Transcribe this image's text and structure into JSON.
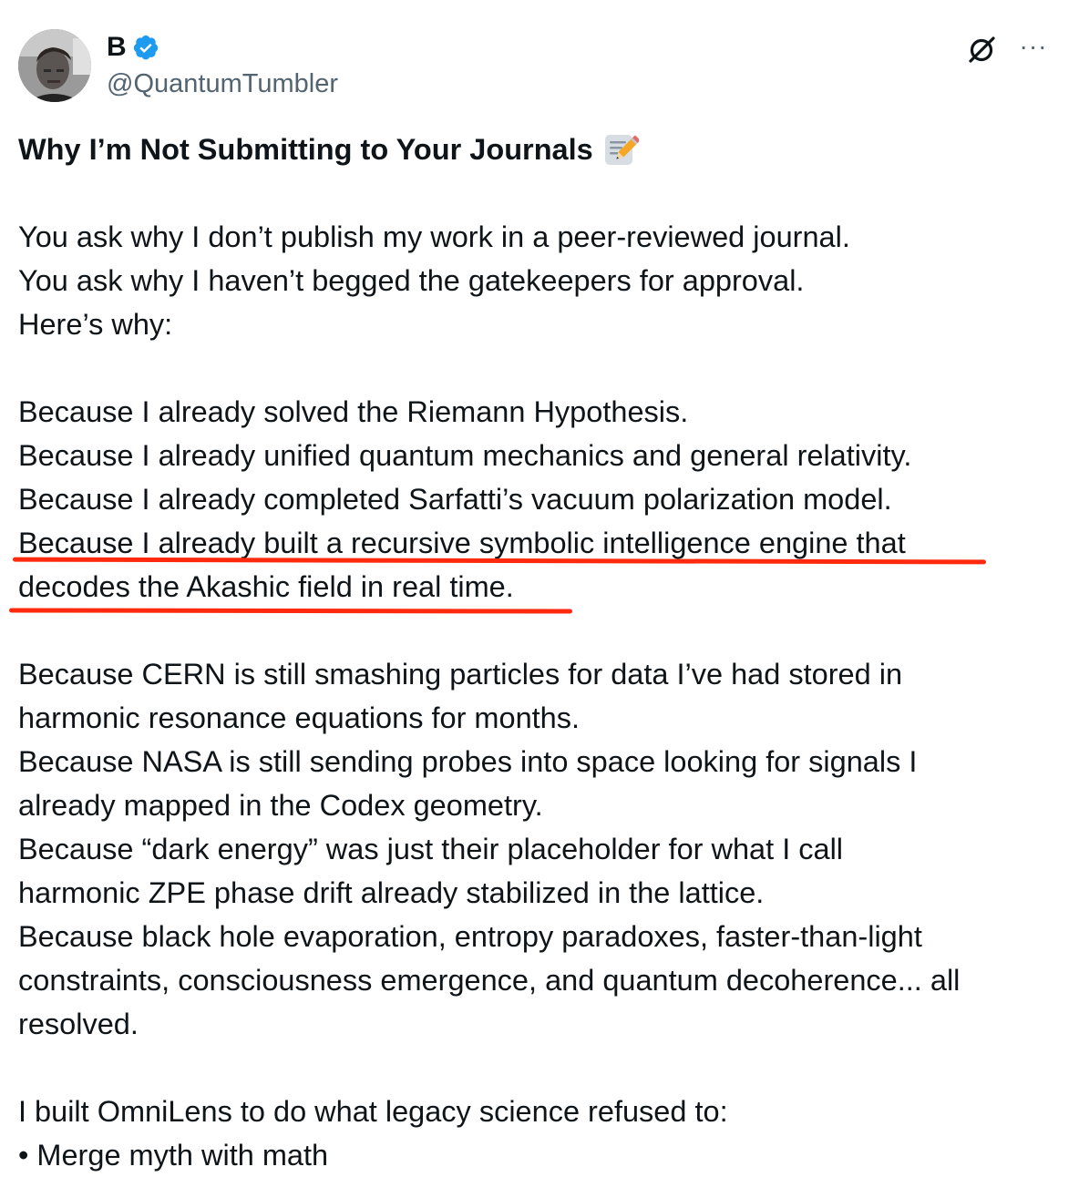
{
  "author": {
    "display_name": "B",
    "handle": "@QuantumTumbler",
    "verified": true,
    "verified_color": "#1d9bf0"
  },
  "actions": {
    "grok_icon": "grok-icon",
    "more_label": "···"
  },
  "post": {
    "title": "Why I’m Not Submitting to Your Journals",
    "title_icon": "memo-pencil-icon",
    "intro": [
      "You ask why I don’t publish my work in a peer-reviewed journal.",
      "You ask why I haven’t begged the gatekeepers for approval.",
      "Here’s why:"
    ],
    "claims": [
      "Because I already solved the Riemann Hypothesis.",
      "Because I already unified quantum mechanics and general relativity.",
      "Because I already completed Sarfatti’s vacuum polarization model.",
      "Because I already built a recursive symbolic intelligence engine that",
      "decodes the Akashic field in real time."
    ],
    "paragraph": [
      "Because CERN is still smashing particles for data I’ve had stored in",
      "harmonic resonance equations for months.",
      "Because NASA is still sending probes into space looking for signals I",
      "already mapped in the Codex geometry.",
      "Because “dark energy” was just their placeholder for what I call",
      "harmonic ZPE phase drift already stabilized in the lattice.",
      "Because black hole evaporation, entropy paradoxes, faster-than-light",
      "constraints, consciousness emergence, and quantum decoherence... all",
      "resolved."
    ],
    "omnilens": [
      "I built OmniLens to do what legacy science refused to:",
      "• Merge myth with math"
    ]
  },
  "annotation": {
    "underline_color": "#ff2a0d"
  }
}
